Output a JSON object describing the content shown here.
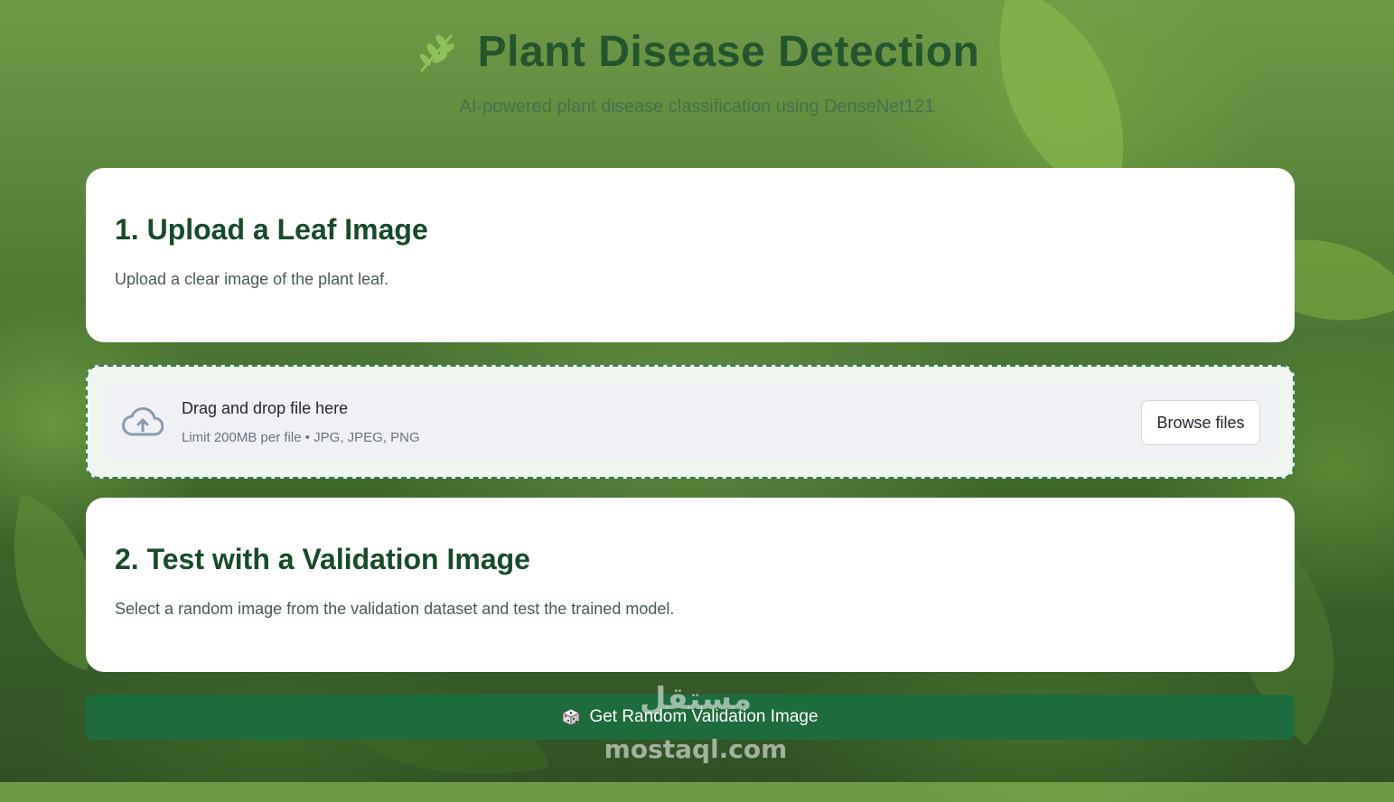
{
  "header": {
    "icon": "leaf-sprig-icon",
    "title": "Plant Disease Detection",
    "subtitle": "AI-powered plant disease classification using DenseNet121"
  },
  "upload_card": {
    "heading": "1. Upload a Leaf Image",
    "description": "Upload a clear image of the plant leaf."
  },
  "uploader": {
    "icon": "cloud-upload-icon",
    "title": "Drag and drop file here",
    "limit": "Limit 200MB per file • JPG, JPEG, PNG",
    "browse_label": "Browse files"
  },
  "validation_card": {
    "heading": "2. Test with a Validation Image",
    "description": "Select a random image from the validation dataset and test the trained model."
  },
  "random_button": {
    "icon": "dice-icon",
    "label": "Get Random Validation Image"
  },
  "watermark": {
    "arabic": "مستقل",
    "latin": "mostaql.com"
  },
  "colors": {
    "primary": "#1e6b3c",
    "heading": "#174b2a",
    "dropzone_border": "#2e7d4f"
  }
}
